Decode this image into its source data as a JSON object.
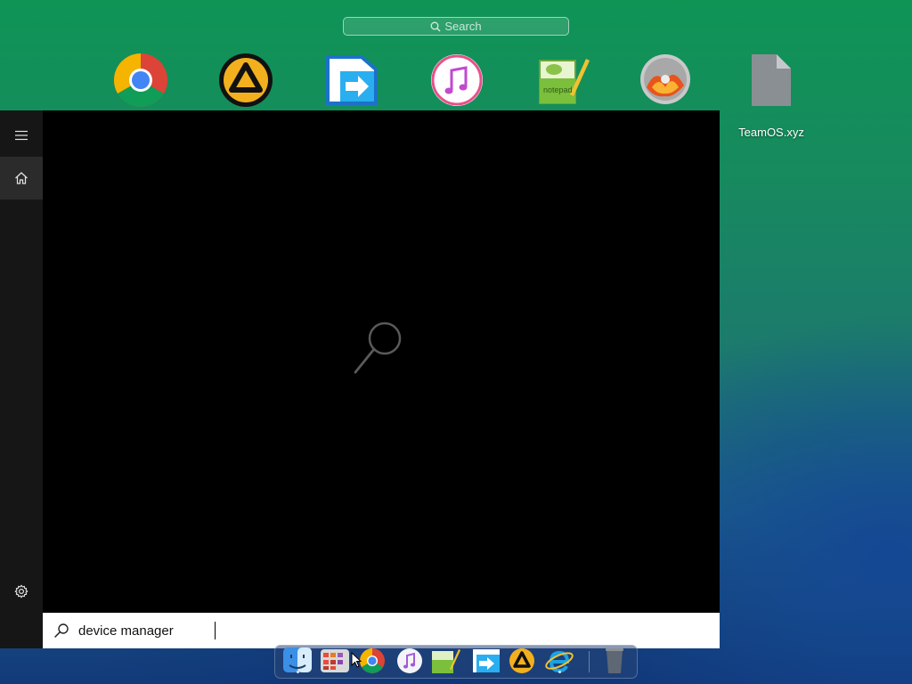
{
  "launchpad": {
    "search_placeholder": "Search",
    "apps": [
      {
        "name": "Google Chrome",
        "icon": "chrome-icon"
      },
      {
        "name": "AIMP",
        "icon": "aimp-icon"
      },
      {
        "name": "File Transfer",
        "icon": "file-transfer-icon"
      },
      {
        "name": "iTunes",
        "icon": "itunes-icon"
      },
      {
        "name": "Notepad++",
        "icon": "notepad-plus-plus-icon"
      },
      {
        "name": "CD Burner",
        "icon": "disc-burner-icon"
      },
      {
        "name": "TeamOS.xyz",
        "icon": "document-file-icon"
      }
    ],
    "file_label": "TeamOS.xyz"
  },
  "start_menu": {
    "rail": [
      {
        "icon": "hamburger-menu-icon"
      },
      {
        "icon": "home-icon",
        "active": true
      },
      {
        "icon": "gear-icon"
      }
    ],
    "search": {
      "value": "device manager",
      "icon": "search-icon"
    }
  },
  "dock": {
    "items": [
      {
        "icon": "finder-icon",
        "running": true
      },
      {
        "icon": "launchpad-icon",
        "running": false
      },
      {
        "icon": "chrome-icon",
        "running": false
      },
      {
        "icon": "itunes-icon",
        "running": false
      },
      {
        "icon": "notepad-plus-plus-icon",
        "running": false
      },
      {
        "icon": "file-transfer-icon",
        "running": false
      },
      {
        "icon": "aimp-icon",
        "running": false
      },
      {
        "icon": "internet-explorer-icon",
        "running": true
      },
      {
        "icon": "trash-icon",
        "running": false
      }
    ]
  },
  "colors": {
    "accent": "#ffffff",
    "start_bg": "#000000",
    "rail_bg": "#161616"
  }
}
